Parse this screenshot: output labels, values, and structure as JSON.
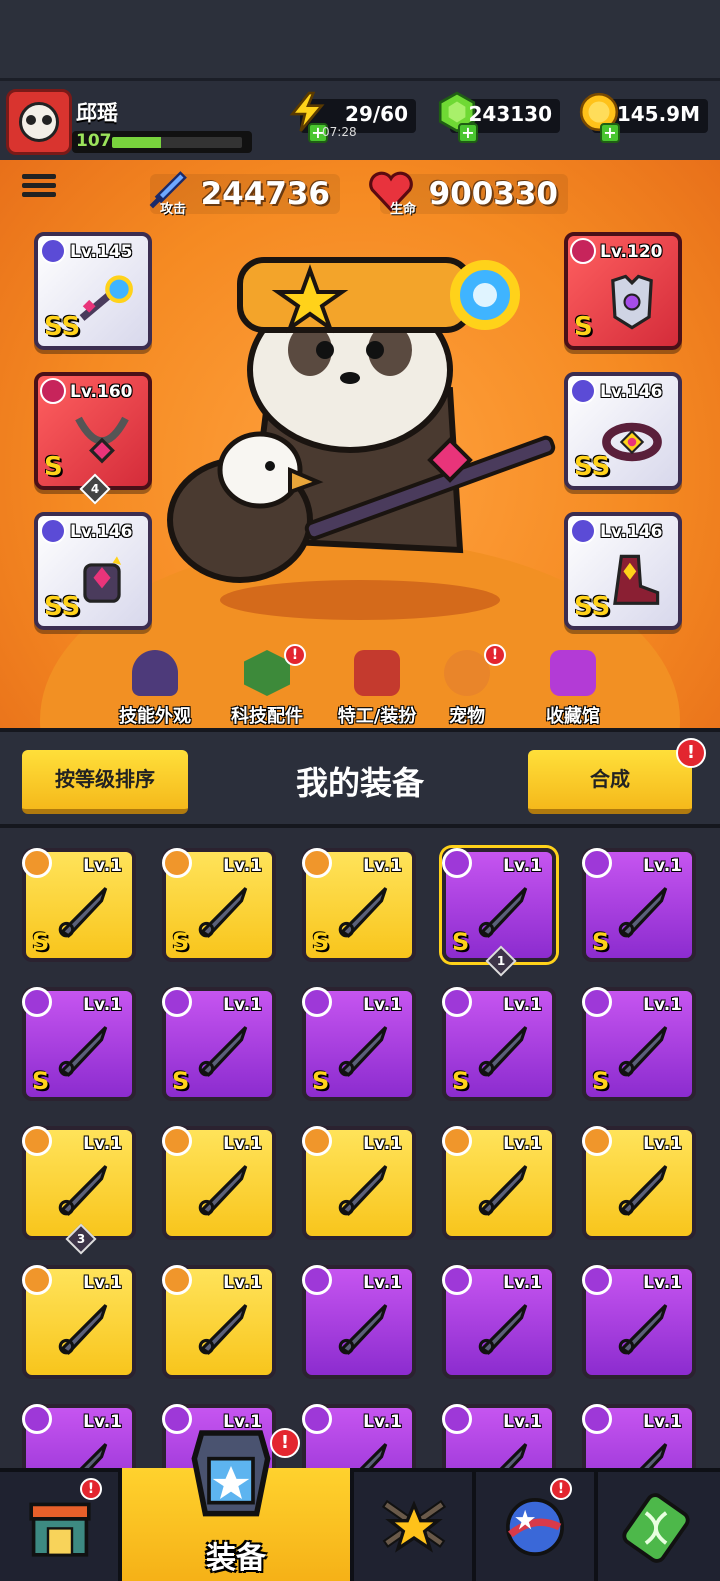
{
  "player": {
    "name": "邱瑶",
    "level": "107",
    "xp_fraction": 0.38
  },
  "resources": {
    "energy": "29/60",
    "energy_timer": "07:28",
    "gems": "243130",
    "coins": "145.9M"
  },
  "stats": {
    "attack_label": "攻击",
    "attack_value": "244736",
    "hp_label": "生命",
    "hp_value": "900330"
  },
  "equipped": {
    "weapon": {
      "level": "Lv.145",
      "rank": "SS"
    },
    "necklace": {
      "level": "Lv.160",
      "rank": "S",
      "badge": "4"
    },
    "gloves": {
      "level": "Lv.146",
      "rank": "SS"
    },
    "armor": {
      "level": "Lv.120",
      "rank": "S"
    },
    "belt": {
      "level": "Lv.146",
      "rank": "SS"
    },
    "boots": {
      "level": "Lv.146",
      "rank": "SS"
    }
  },
  "subnav": [
    {
      "label": "技能外观",
      "alert": false
    },
    {
      "label": "科技配件",
      "alert": true
    },
    {
      "label": "特工/装扮",
      "alert": false
    },
    {
      "label": "宠物",
      "alert": true
    },
    {
      "label": "收藏馆",
      "alert": false
    }
  ],
  "inventory_header": {
    "sort_label": "按等级排序",
    "title": "我的装备",
    "merge_label": "合成",
    "merge_alert": "!"
  },
  "inventory": [
    {
      "level": "Lv.1",
      "rank": "S",
      "color": "gold",
      "icon": "knife-icon"
    },
    {
      "level": "Lv.1",
      "rank": "S",
      "color": "gold",
      "icon": "chain-necklace-icon"
    },
    {
      "level": "Lv.1",
      "rank": "S",
      "color": "gold",
      "icon": "gauntlet-icon"
    },
    {
      "level": "Lv.1",
      "rank": "S",
      "color": "purple",
      "icon": "boot-icon",
      "badge": "1",
      "selected": true
    },
    {
      "level": "Lv.1",
      "rank": "S",
      "color": "purple",
      "icon": "armor-icon"
    },
    {
      "level": "Lv.1",
      "rank": "S",
      "color": "purple",
      "icon": "ring-necklace-icon"
    },
    {
      "level": "Lv.1",
      "rank": "S",
      "color": "purple",
      "icon": "belt-icon"
    },
    {
      "level": "Lv.1",
      "rank": "S",
      "color": "purple",
      "icon": "belt-icon"
    },
    {
      "level": "Lv.1",
      "rank": "S",
      "color": "purple",
      "icon": "boot-icon"
    },
    {
      "level": "Lv.1",
      "rank": "S",
      "color": "purple",
      "icon": "boot-icon"
    },
    {
      "level": "Lv.1",
      "rank": "",
      "color": "gold",
      "icon": "sneaker-icon",
      "badge": "3"
    },
    {
      "level": "Lv.1",
      "rank": "",
      "color": "gold",
      "icon": "kunai-icon"
    },
    {
      "level": "Lv.1",
      "rank": "",
      "color": "gold",
      "icon": "machete-icon"
    },
    {
      "level": "Lv.1",
      "rank": "",
      "color": "gold",
      "icon": "revolver-icon"
    },
    {
      "level": "Lv.1",
      "rank": "",
      "color": "gold",
      "icon": "bat-icon"
    },
    {
      "level": "Lv.1",
      "rank": "",
      "color": "gold",
      "icon": "fang-necklace-icon"
    },
    {
      "level": "Lv.1",
      "rank": "",
      "color": "gold",
      "icon": "sneaker-icon"
    },
    {
      "level": "Lv.1",
      "rank": "",
      "color": "purple",
      "icon": "kunai-icon"
    },
    {
      "level": "Lv.1",
      "rank": "",
      "color": "purple",
      "icon": "kunai-icon"
    },
    {
      "level": "Lv.1",
      "rank": "",
      "color": "purple",
      "icon": "kunai-icon"
    },
    {
      "level": "Lv.1",
      "rank": "",
      "color": "purple",
      "icon": "kunai-icon"
    },
    {
      "level": "Lv.1",
      "rank": "",
      "color": "purple",
      "icon": "kunai-icon"
    },
    {
      "level": "Lv.1",
      "rank": "",
      "color": "purple",
      "icon": "kunai-icon"
    },
    {
      "level": "Lv.1",
      "rank": "",
      "color": "purple",
      "icon": "kunai-icon"
    },
    {
      "level": "Lv.1",
      "rank": "",
      "color": "purple",
      "icon": "kunai-icon"
    }
  ],
  "bottom_nav": [
    {
      "icon": "shop-icon",
      "label": "",
      "alert": true
    },
    {
      "icon": "equipment-icon",
      "label": "装备",
      "alert": true,
      "active": true
    },
    {
      "icon": "battle-icon",
      "label": "",
      "alert": false
    },
    {
      "icon": "planet-icon",
      "label": "",
      "alert": true
    },
    {
      "icon": "dna-icon",
      "label": "",
      "alert": false
    }
  ],
  "colors": {
    "accent": "#f5b91b",
    "hero_bg": "#f58a22",
    "panel": "#2a2e3a",
    "alert": "#e3262f"
  }
}
